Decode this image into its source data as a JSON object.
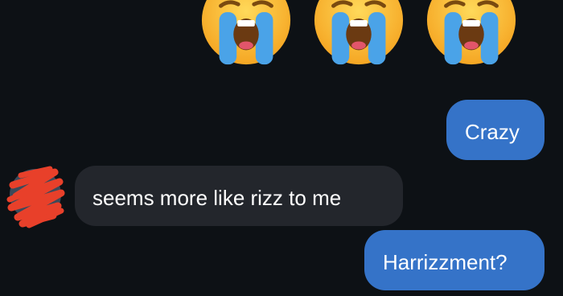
{
  "reactions": [
    {
      "icon": "loudly-crying-face-icon"
    },
    {
      "icon": "loudly-crying-face-icon"
    },
    {
      "icon": "loudly-crying-face-icon"
    }
  ],
  "messages": [
    {
      "sender": "me",
      "text": "Crazy"
    },
    {
      "sender": "other",
      "text": "seems more like rizz to me"
    },
    {
      "sender": "me",
      "text": "Harrizzment?"
    }
  ],
  "avatar": {
    "icon": "scribbled-out-avatar-icon"
  },
  "colors": {
    "background": "#0d1115",
    "sent_bubble": "#3573c8",
    "received_bubble": "#23262c",
    "avatar_scribble": "#e8402a"
  }
}
